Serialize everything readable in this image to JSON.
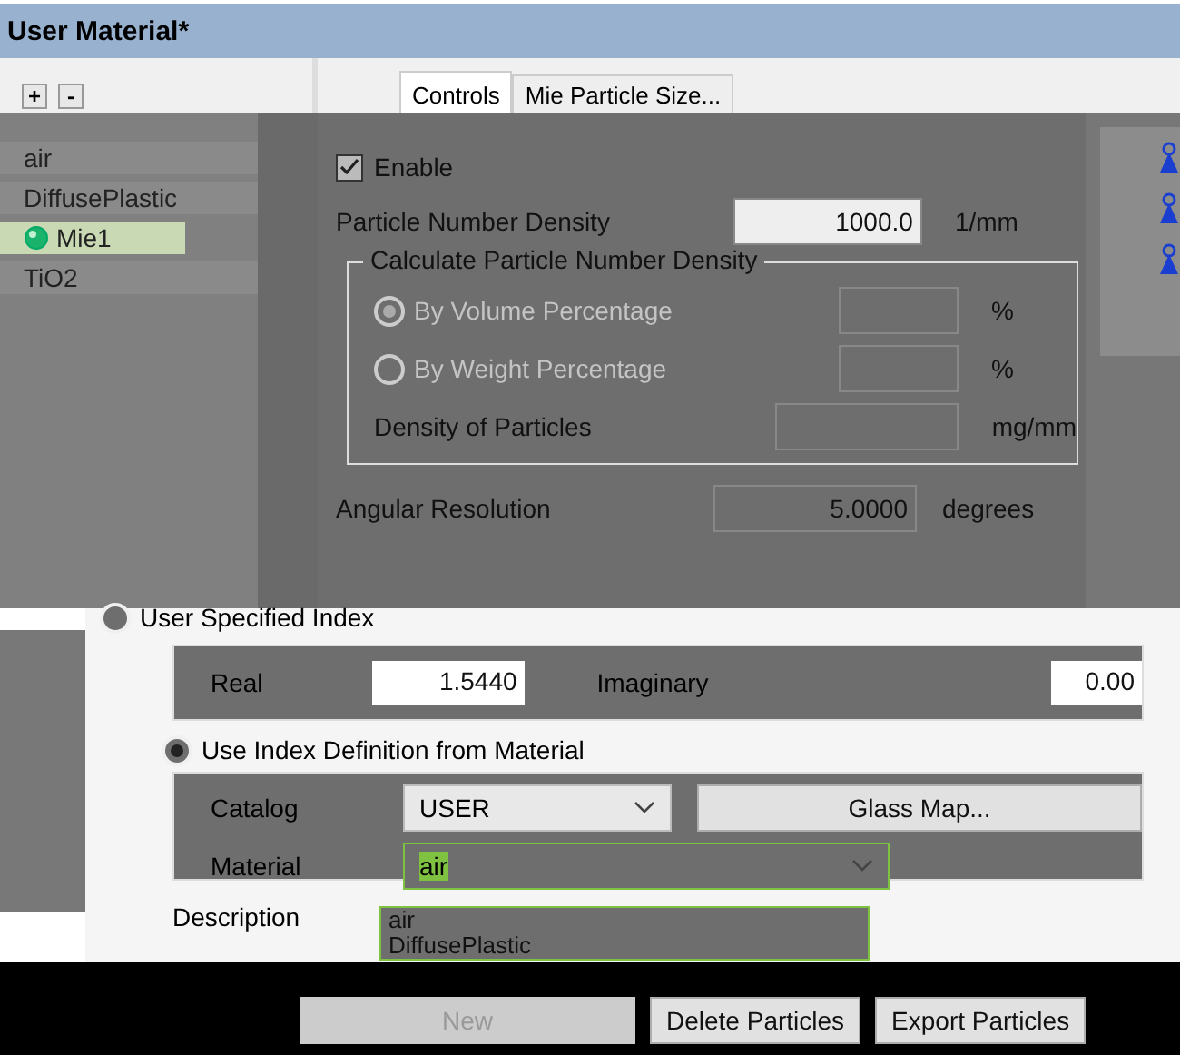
{
  "window": {
    "title": "User Material*"
  },
  "list_toolbar": {
    "add": "+",
    "remove": "-"
  },
  "materials": [
    {
      "name": "air",
      "kind": "plain",
      "selected": false
    },
    {
      "name": "DiffusePlastic",
      "kind": "plain",
      "selected": false
    },
    {
      "name": "Mie1",
      "kind": "mie",
      "selected": true
    },
    {
      "name": "TiO2",
      "kind": "plain",
      "selected": false
    }
  ],
  "tabs": [
    {
      "label": "Controls",
      "selected": true
    },
    {
      "label": "Mie Particle Size...",
      "selected": false
    }
  ],
  "enable": {
    "label": "Enable",
    "checked": true
  },
  "density": {
    "label": "Particle Number Density",
    "value": "1000.0",
    "unit": "1/mm"
  },
  "calculate": {
    "title": "Calculate Particle Number Density",
    "options": [
      {
        "label": "By Volume Percentage",
        "unit": "%",
        "selected": true,
        "disabled": true
      },
      {
        "label": "By Weight Percentage",
        "unit": "%",
        "selected": false,
        "disabled": true
      }
    ],
    "density_of_particles": {
      "label": "Density of Particles",
      "unit": "mg/mm"
    }
  },
  "angular": {
    "label": "Angular Resolution",
    "value": "5.0000",
    "unit": "degrees"
  },
  "user_index": {
    "label": "User Specified Index",
    "selected": false,
    "real_label": "Real",
    "real": "1.5440",
    "imag_label": "Imaginary",
    "imag": "0.00"
  },
  "material_index": {
    "label": "Use Index Definition from Material",
    "selected": true,
    "catalog_label": "Catalog",
    "catalog": "USER",
    "glass_map": "Glass Map...",
    "material_label": "Material",
    "material": "air",
    "options": [
      "air",
      "DiffusePlastic"
    ]
  },
  "description": {
    "label": "Description"
  },
  "buttons": [
    {
      "label": "New",
      "disabled": true
    },
    {
      "label": "Delete Particles",
      "disabled": false
    },
    {
      "label": "Export Particles",
      "disabled": false
    }
  ]
}
